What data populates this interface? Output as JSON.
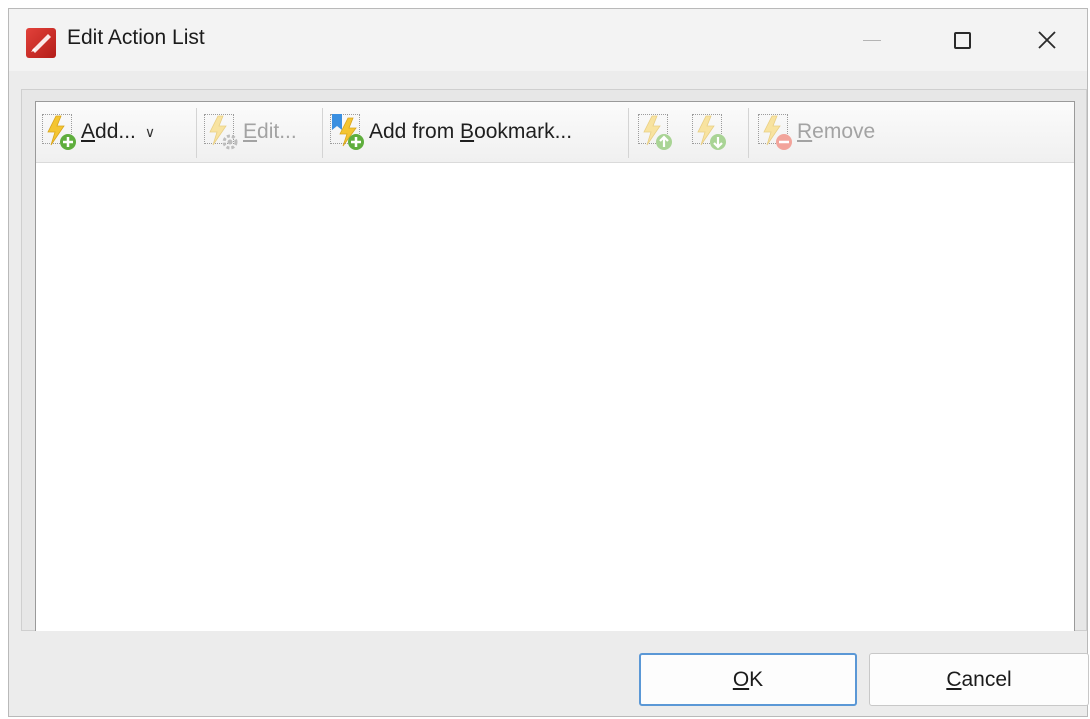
{
  "window": {
    "title": "Edit Action List",
    "icon": "pdf-editor-app-icon"
  },
  "toolbar": {
    "add_label": "Add...",
    "add_accesskey": "A",
    "edit_label": "Edit...",
    "edit_accesskey": "E",
    "add_bookmark_label": "Add from Bookmark...",
    "add_bookmark_prefix": "Add from ",
    "add_bookmark_accesskey": "B",
    "add_bookmark_suffix": "ookmark...",
    "move_up_icon": "lightning-up-icon",
    "move_down_icon": "lightning-down-icon",
    "remove_label": "Remove",
    "remove_accesskey": "R"
  },
  "list": {
    "items": []
  },
  "buttons": {
    "ok_label": "OK",
    "cancel_label": "Cancel"
  },
  "colors": {
    "accent_border": "#5b98d6",
    "bolt_yellow": "#f4c531",
    "plus_green": "#5fae3d",
    "minus_red": "#e8665a",
    "app_red": "#c4271f"
  }
}
